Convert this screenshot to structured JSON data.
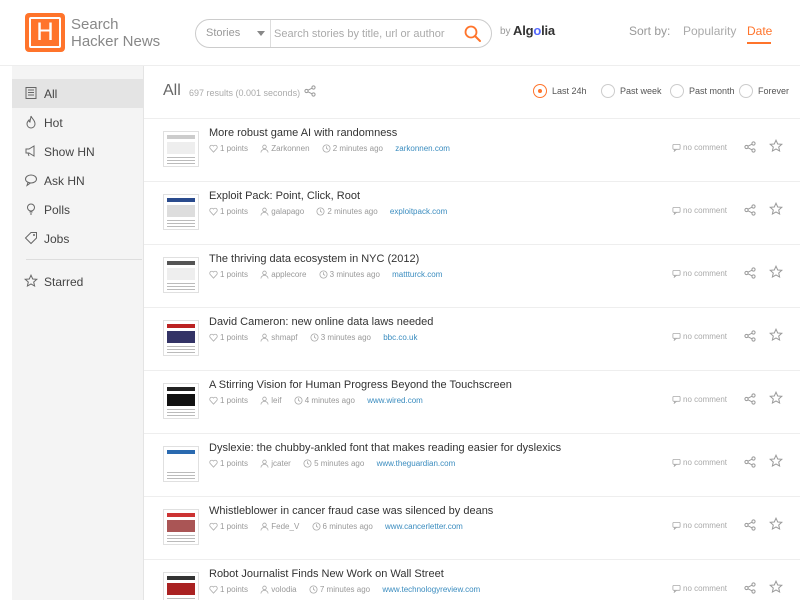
{
  "header": {
    "logo_letter": "H",
    "brand_line1": "Search",
    "brand_line2": "Hacker News",
    "search_type": "Stories",
    "search_placeholder": "Search stories by title, url or author",
    "by": "by",
    "algolia_pre": "Alg",
    "algolia_o": "o",
    "algolia_post": "lia",
    "sort_by": "Sort by:",
    "sort_popularity": "Popularity",
    "sort_date": "Date"
  },
  "sidebar": {
    "items": [
      {
        "label": "All",
        "icon": "newspaper-icon"
      },
      {
        "label": "Hot",
        "icon": "flame-icon"
      },
      {
        "label": "Show HN",
        "icon": "megaphone-icon"
      },
      {
        "label": "Ask HN",
        "icon": "speech-bubble-icon"
      },
      {
        "label": "Polls",
        "icon": "lightbulb-icon"
      },
      {
        "label": "Jobs",
        "icon": "tag-icon"
      },
      {
        "label": "Starred",
        "icon": "star-icon"
      }
    ]
  },
  "main": {
    "title": "All",
    "stats": "697 results (0.001 seconds)",
    "ranges": [
      "Last 24h",
      "Past week",
      "Past month",
      "Forever"
    ],
    "selected_range": "Last 24h"
  },
  "stories": [
    {
      "title": "More robust game AI with randomness",
      "points": "1 points",
      "author": "Zarkonnen",
      "time": "2 minutes ago",
      "url": "zarkonnen.com",
      "comments": "no comment"
    },
    {
      "title": "Exploit Pack: Point, Click, Root",
      "points": "1 points",
      "author": "galapago",
      "time": "2 minutes ago",
      "url": "exploitpack.com",
      "comments": "no comment"
    },
    {
      "title": "The thriving data ecosystem in NYC (2012)",
      "points": "1 points",
      "author": "applecore",
      "time": "3 minutes ago",
      "url": "mattturck.com",
      "comments": "no comment"
    },
    {
      "title": "David Cameron: new online data laws needed",
      "points": "1 points",
      "author": "shmapf",
      "time": "3 minutes ago",
      "url": "bbc.co.uk",
      "comments": "no comment"
    },
    {
      "title": "A Stirring Vision for Human Progress Beyond the Touchscreen",
      "points": "1 points",
      "author": "leif",
      "time": "4 minutes ago",
      "url": "www.wired.com",
      "comments": "no comment"
    },
    {
      "title": "Dyslexie: the chubby-ankled font that makes reading easier for dyslexics",
      "points": "1 points",
      "author": "jcater",
      "time": "5 minutes ago",
      "url": "www.theguardian.com",
      "comments": "no comment"
    },
    {
      "title": "Whistleblower in cancer fraud case was silenced by deans",
      "points": "1 points",
      "author": "Fede_V",
      "time": "6 minutes ago",
      "url": "www.cancerletter.com",
      "comments": "no comment"
    },
    {
      "title": "Robot Journalist Finds New Work on Wall Street",
      "points": "1 points",
      "author": "volodia",
      "time": "7 minutes ago",
      "url": "www.technologyreview.com",
      "comments": "no comment"
    }
  ],
  "colors": {
    "accent": "#ff742b",
    "link": "#3a8cbf",
    "algolia": "#5468ff"
  }
}
